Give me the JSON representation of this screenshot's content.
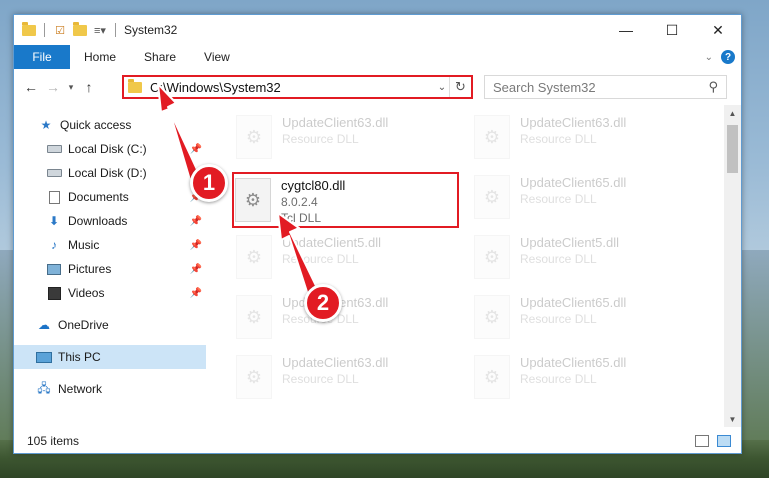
{
  "window": {
    "title": "System32",
    "controls": {
      "minimize": "—",
      "maximize": "☐",
      "close": "✕"
    }
  },
  "ribbon": {
    "file": "File",
    "tabs": [
      "Home",
      "Share",
      "View"
    ]
  },
  "address": {
    "path": "C:\\Windows\\System32",
    "search_placeholder": "Search System32"
  },
  "sidebar": {
    "items": [
      {
        "label": "Quick access",
        "icon": "star-icon"
      },
      {
        "label": "Local Disk (C:)",
        "icon": "drive-icon",
        "pinned": true
      },
      {
        "label": "Local Disk (D:)",
        "icon": "drive-icon"
      },
      {
        "label": "Documents",
        "icon": "documents-icon",
        "pinned": true
      },
      {
        "label": "Downloads",
        "icon": "downloads-icon",
        "pinned": true
      },
      {
        "label": "Music",
        "icon": "music-icon",
        "pinned": true
      },
      {
        "label": "Pictures",
        "icon": "pictures-icon",
        "pinned": true
      },
      {
        "label": "Videos",
        "icon": "videos-icon",
        "pinned": true
      },
      {
        "label": "OneDrive",
        "icon": "cloud-icon"
      },
      {
        "label": "This PC",
        "icon": "pc-icon",
        "selected": true
      },
      {
        "label": "Network",
        "icon": "network-icon"
      }
    ]
  },
  "files": {
    "highlighted": {
      "name": "cygtcl80.dll",
      "version": "8.0.2.4",
      "type": "Tcl DLL"
    },
    "background": [
      {
        "name": "UpdateClient63.dll",
        "type": "Resource DLL"
      },
      {
        "name": "UpdateClient63.dll",
        "type": "Resource DLL"
      },
      {
        "name": "UpdateClient65.dll",
        "type": "Resource DLL"
      },
      {
        "name": "UpdateClient5.dll",
        "type": "Resource DLL"
      },
      {
        "name": "UpdateClient5.dll",
        "type": "Resource DLL"
      },
      {
        "name": "UpdateClient63.dll",
        "type": "Resource DLL"
      },
      {
        "name": "UpdateClient65.dll",
        "type": "Resource DLL"
      },
      {
        "name": "UpdateClient63.dll",
        "type": "Resource DLL"
      },
      {
        "name": "UpdateClient65.dll",
        "type": "Resource DLL"
      }
    ]
  },
  "status": {
    "items_count": "105 items"
  },
  "annotations": {
    "step1": "1",
    "step2": "2",
    "color": "#e21b23"
  }
}
